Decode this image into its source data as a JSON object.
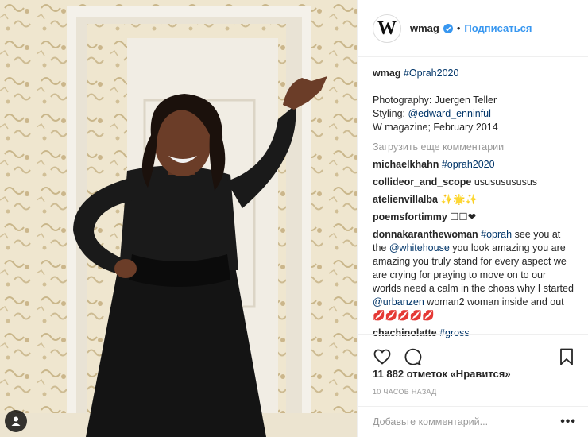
{
  "photo": {
    "alt": "Woman in a black dress posing in a doorway with toile wallpaper"
  },
  "header": {
    "avatar_letter": "W",
    "username": "wmag",
    "separator": "•",
    "follow_label": "Подписаться"
  },
  "caption": {
    "username": "wmag",
    "hashtag": "#Oprah2020",
    "dash": "-",
    "photography": "Photography: Juergen Teller",
    "styling_prefix": "Styling: ",
    "styling_handle": "@edward_enninful",
    "magazine": "W magazine; February 2014"
  },
  "load_more_label": "Загрузить еще комментарии",
  "comments": [
    {
      "user": "michaelkhahn",
      "parts": [
        {
          "text": "#oprah2020",
          "link": true
        }
      ]
    },
    {
      "user": "collideor_and_scope",
      "parts": [
        {
          "text": "usususususus",
          "link": false
        }
      ]
    },
    {
      "user": "atelienvillalba",
      "parts": [
        {
          "text": "✨🌟✨",
          "link": false
        }
      ]
    },
    {
      "user": "poemsfortimmy",
      "parts": [
        {
          "text": "☐☐❤",
          "link": false
        }
      ]
    },
    {
      "user": "donnakaranthewoman",
      "parts": [
        {
          "text": "#oprah",
          "link": true
        },
        {
          "text": " see you at the ",
          "link": false
        },
        {
          "text": "@whitehouse",
          "link": true
        },
        {
          "text": " you look amazing you are amazing you truly stand for every aspect we are crying for praying to move on to our worlds need a calm in the choas why I started ",
          "link": false
        },
        {
          "text": "@urbanzen",
          "link": true
        },
        {
          "text": " woman2 woman inside and out 💋💋💋💋💋",
          "link": false
        }
      ]
    },
    {
      "user": "chachinolatte",
      "parts": [
        {
          "text": "#gross",
          "link": true
        }
      ]
    }
  ],
  "likes_text": "11 882 отметок «Нравится»",
  "timestamp": "10 часов назад",
  "add_comment_placeholder": "Добавьте комментарий...",
  "more_label": "•••",
  "colors": {
    "accent": "#3897f0",
    "link": "#003569",
    "muted": "#999999",
    "text": "#262626",
    "border": "#efefef"
  }
}
